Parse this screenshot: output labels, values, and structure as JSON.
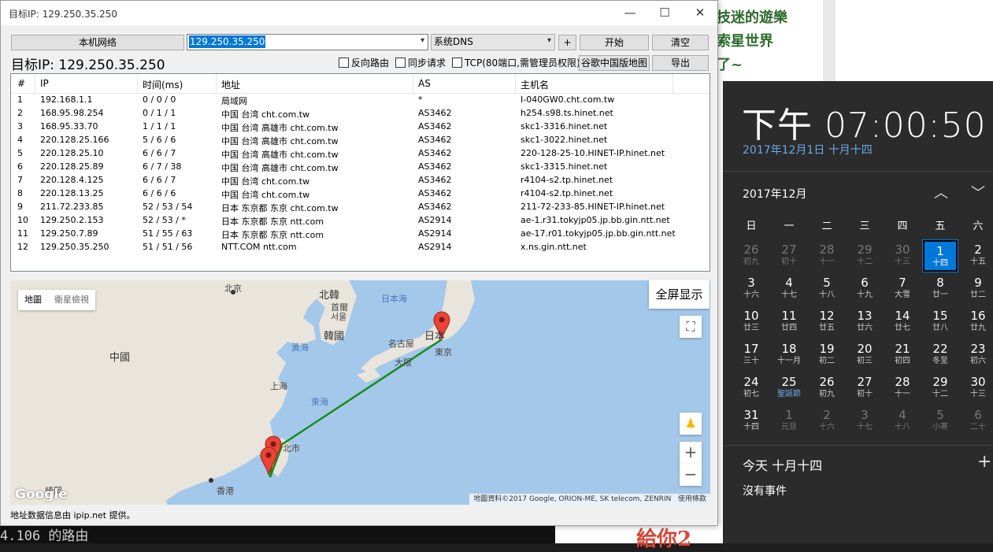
{
  "window": {
    "title": "目标IP: 129.250.35.250",
    "controls": [
      "—",
      "☐",
      "✕"
    ]
  },
  "toolbar": {
    "local_network_button": "本机网络",
    "target_input_value": "129.250.35.250",
    "dns_select_value": "系统DNS",
    "plus_button": "+",
    "start_button": "开始",
    "clear_button": "清空",
    "google_map_button": "谷歌中国版地图",
    "export_button": "导出"
  },
  "target_heading": "目标IP: 129.250.35.250",
  "options": {
    "reverse_route": "反向路由",
    "sync_request": "同步请求",
    "tcp": "TCP(80端口,需管理员权限)"
  },
  "table": {
    "headers": [
      "#",
      "IP",
      "时间(ms)",
      "地址",
      "AS",
      "主机名"
    ],
    "rows": [
      [
        "1",
        "192.168.1.1",
        "0 / 0 / 0",
        "局域网",
        "*",
        "I-040GW0.cht.com.tw"
      ],
      [
        "2",
        "168.95.98.254",
        "0 / 1 / 1",
        "中国 台湾 cht.com.tw",
        "AS3462",
        "h254.s98.ts.hinet.net"
      ],
      [
        "3",
        "168.95.33.70",
        "1 / 1 / 1",
        "中国 台湾 高雄市 cht.com.tw",
        "AS3462",
        "skc1-3316.hinet.net"
      ],
      [
        "4",
        "220.128.25.166",
        "5 / 6 / 6",
        "中国 台湾 高雄市 cht.com.tw",
        "AS3462",
        "skc1-3022.hinet.net"
      ],
      [
        "5",
        "220.128.25.10",
        "6 / 6 / 7",
        "中国 台湾 高雄市 cht.com.tw",
        "AS3462",
        "220-128-25-10.HINET-IP.hinet.net"
      ],
      [
        "6",
        "220.128.25.89",
        "6 / 7 / 38",
        "中国 台湾 高雄市 cht.com.tw",
        "AS3462",
        "skc1-3315.hinet.net"
      ],
      [
        "7",
        "220.128.4.125",
        "6 / 6 / 7",
        "中国 台湾 cht.com.tw",
        "AS3462",
        "r4104-s2.tp.hinet.net"
      ],
      [
        "8",
        "220.128.13.25",
        "6 / 6 / 6",
        "中国 台湾 cht.com.tw",
        "AS3462",
        "r4104-s2.tp.hinet.net"
      ],
      [
        "9",
        "211.72.233.85",
        "52 / 53 / 54",
        "日本 东京都 东京 cht.com.tw",
        "AS3462",
        "211-72-233-85.HINET-IP.hinet.net"
      ],
      [
        "10",
        "129.250.2.153",
        "52 / 53 / *",
        "日本 东京都 东京 ntt.com",
        "AS2914",
        "ae-1.r31.tokyjp05.jp.bb.gin.ntt.net"
      ],
      [
        "11",
        "129.250.7.89",
        "51 / 55 / 63",
        "日本 东京都 东京 ntt.com",
        "AS2914",
        "ae-17.r01.tokyjp05.jp.bb.gin.ntt.net"
      ],
      [
        "12",
        "129.250.35.250",
        "51 / 51 / 56",
        "NTT.COM ntt.com",
        "AS2914",
        "x.ns.gin.ntt.net"
      ]
    ]
  },
  "map": {
    "type_map": "地圖",
    "type_satellite": "衛星檢視",
    "fullscreen_button": "全屏显示",
    "zoom_in": "+",
    "zoom_out": "−",
    "attribution": "地圖資料©2017 Google, ORION-ME, SK telecom, ZENRIN",
    "terms": "使用條款",
    "google_logo": "Google",
    "labels": {
      "beijing": "北京",
      "north_korea": "北韓",
      "pyongyang": "平壤",
      "seoul_prefix": "首爾",
      "seoul": "서울",
      "south_korea": "韓國",
      "china": "中國",
      "yellow_sea": "黃海",
      "japan_sea": "日本海",
      "japan": "日本",
      "nagoya": "名古屋",
      "osaka": "大阪",
      "tokyo": "東京",
      "shanghai": "上海",
      "east_sea": "東海",
      "taipei": "北市",
      "hongkong": "香港",
      "guilin": "綺岡"
    },
    "line_color": "#1a8a1a"
  },
  "status_text": "地址数据信息由 ipip.net 提供。",
  "background": {
    "headline1": "技迷的遊樂",
    "headline2": "索星世界",
    "headline3": "了~",
    "bottom_text": "4.106 的路由",
    "bottom_red": "給你2"
  },
  "clock": {
    "time": "下午 07:00:50",
    "date": "2017年12月1日 十月十四",
    "month": "2017年12月",
    "weekdays": [
      "日",
      "一",
      "二",
      "三",
      "四",
      "五",
      "六"
    ],
    "days": [
      {
        "n": "26",
        "l": "初九",
        "dim": true
      },
      {
        "n": "27",
        "l": "初十",
        "dim": true
      },
      {
        "n": "28",
        "l": "十一",
        "dim": true
      },
      {
        "n": "29",
        "l": "十二",
        "dim": true
      },
      {
        "n": "30",
        "l": "十三",
        "dim": true
      },
      {
        "n": "1",
        "l": "十四",
        "today": true
      },
      {
        "n": "2",
        "l": "十五"
      },
      {
        "n": "3",
        "l": "十六"
      },
      {
        "n": "4",
        "l": "十七"
      },
      {
        "n": "5",
        "l": "十八"
      },
      {
        "n": "6",
        "l": "十九"
      },
      {
        "n": "7",
        "l": "大雪"
      },
      {
        "n": "8",
        "l": "廿一"
      },
      {
        "n": "9",
        "l": "廿二"
      },
      {
        "n": "10",
        "l": "廿三"
      },
      {
        "n": "11",
        "l": "廿四"
      },
      {
        "n": "12",
        "l": "廿五"
      },
      {
        "n": "13",
        "l": "廿六"
      },
      {
        "n": "14",
        "l": "廿七"
      },
      {
        "n": "15",
        "l": "廿八"
      },
      {
        "n": "16",
        "l": "廿九"
      },
      {
        "n": "17",
        "l": "三十"
      },
      {
        "n": "18",
        "l": "十一月"
      },
      {
        "n": "19",
        "l": "初二"
      },
      {
        "n": "20",
        "l": "初三"
      },
      {
        "n": "21",
        "l": "初四"
      },
      {
        "n": "22",
        "l": "冬至"
      },
      {
        "n": "23",
        "l": "初六"
      },
      {
        "n": "24",
        "l": "初七"
      },
      {
        "n": "25",
        "l": "聖誕節",
        "fest": true
      },
      {
        "n": "26",
        "l": "初九"
      },
      {
        "n": "27",
        "l": "初十"
      },
      {
        "n": "28",
        "l": "十一"
      },
      {
        "n": "29",
        "l": "十二"
      },
      {
        "n": "30",
        "l": "十三"
      },
      {
        "n": "31",
        "l": "十四"
      },
      {
        "n": "1",
        "l": "元旦",
        "dim": true
      },
      {
        "n": "2",
        "l": "十六",
        "dim": true
      },
      {
        "n": "3",
        "l": "十七",
        "dim": true
      },
      {
        "n": "4",
        "l": "十八",
        "dim": true
      },
      {
        "n": "5",
        "l": "小寒",
        "dim": true
      },
      {
        "n": "6",
        "l": "二十",
        "dim": true
      }
    ],
    "today_label": "今天 十月十四",
    "add_event": "+",
    "no_events": "沒有事件"
  }
}
